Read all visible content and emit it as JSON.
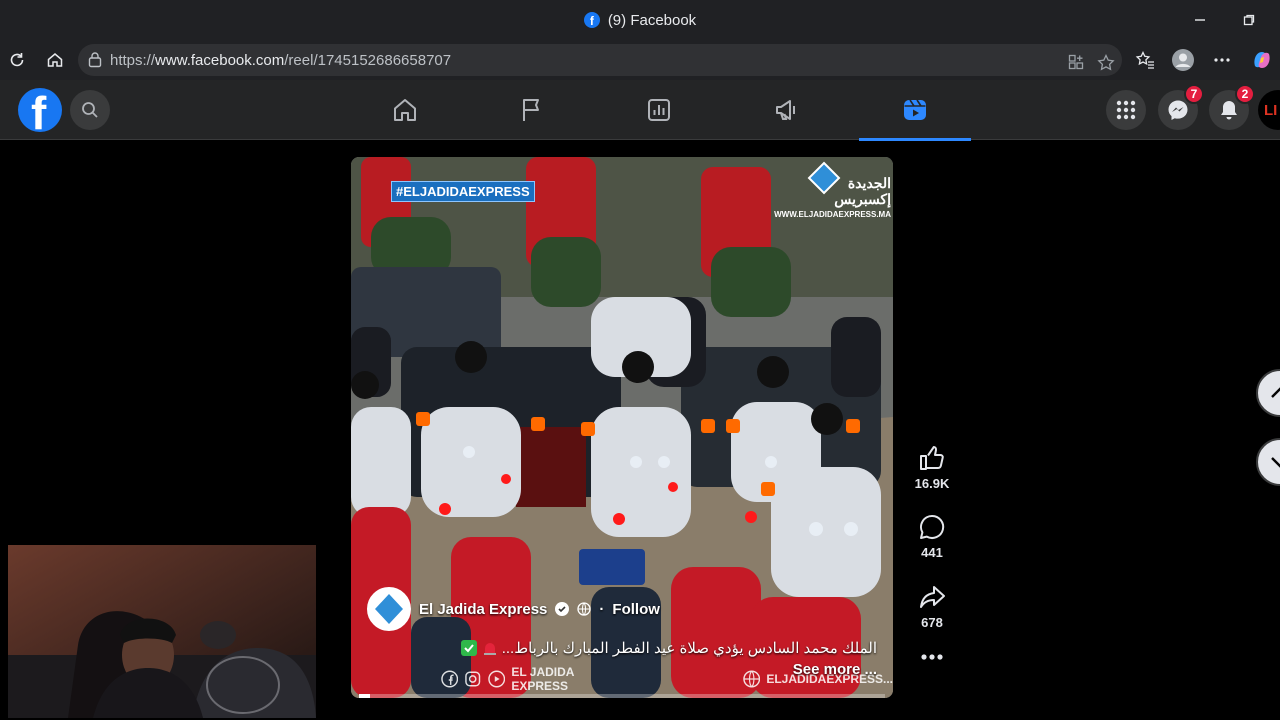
{
  "window": {
    "title": "(9) Facebook"
  },
  "address_bar": {
    "url_prefix": "https://",
    "url_host": "www.facebook.com",
    "url_path": "/reel/1745152686658707"
  },
  "nav": {
    "messenger_badge": "7",
    "notifications_badge": "2",
    "profile_text": "LI"
  },
  "reel": {
    "hashtag": "#ELJADIDAEXPRESS",
    "brand_name": "الجديدة إكسبريس",
    "brand_web": "WWW.ELJADIDAEXPRESS.MA",
    "author": "El Jadida Express",
    "follow_label": "Follow",
    "caption": "الملك محمد السادس يؤدي صلاة عيد الفطر المبارك بالرباط...",
    "see_more": "See more ...",
    "strip_left": "EL JADIDA EXPRESS",
    "strip_right": "ELJADIDAEXPRESS...",
    "progress": 0.02
  },
  "actions": {
    "likes": "16.9K",
    "comments": "441",
    "shares": "678"
  },
  "colors": {
    "accent": "#2d88ff",
    "fb_blue": "#1877f2",
    "badge": "#e41e3f"
  }
}
